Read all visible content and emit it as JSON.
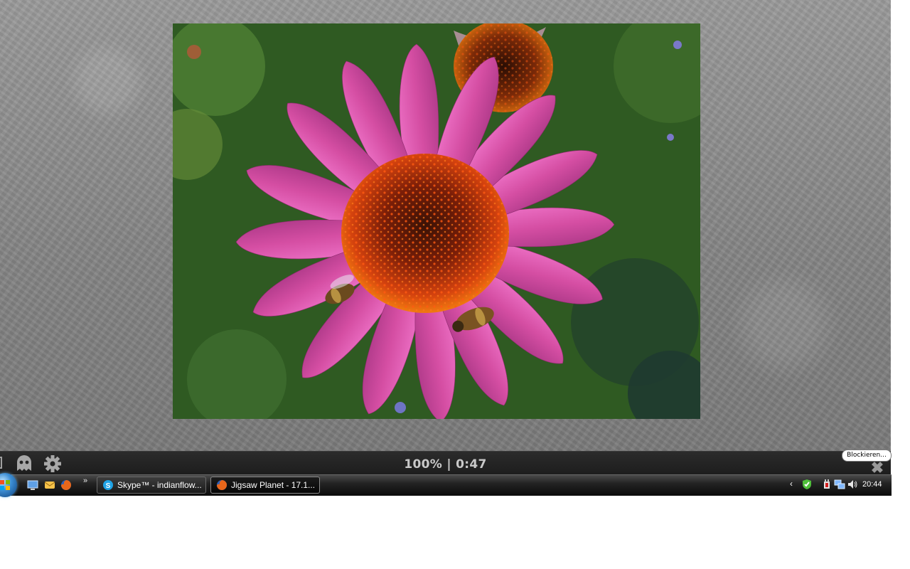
{
  "control_bar": {
    "status_text": "100% | 0:47",
    "tooltip": "Blockieren..."
  },
  "taskbar": {
    "buttons": [
      {
        "label": "Skype™ - indianflow...",
        "icon": "skype-icon"
      },
      {
        "label": "Jigsaw Planet - 17.1...",
        "icon": "firefox-icon"
      }
    ],
    "clock": "20:44"
  },
  "icons": [
    "ghost-icon",
    "gear-icon",
    "close-icon",
    "show-desktop-icon",
    "mail-icon",
    "firefox-icon",
    "skype-icon",
    "shield-check-icon",
    "power-icon",
    "network-icon",
    "speaker-icon"
  ],
  "colors": {
    "petal_pink": "#d94fa6",
    "cone_orange": "#d2461b",
    "foliage_green": "#2f5a22"
  }
}
